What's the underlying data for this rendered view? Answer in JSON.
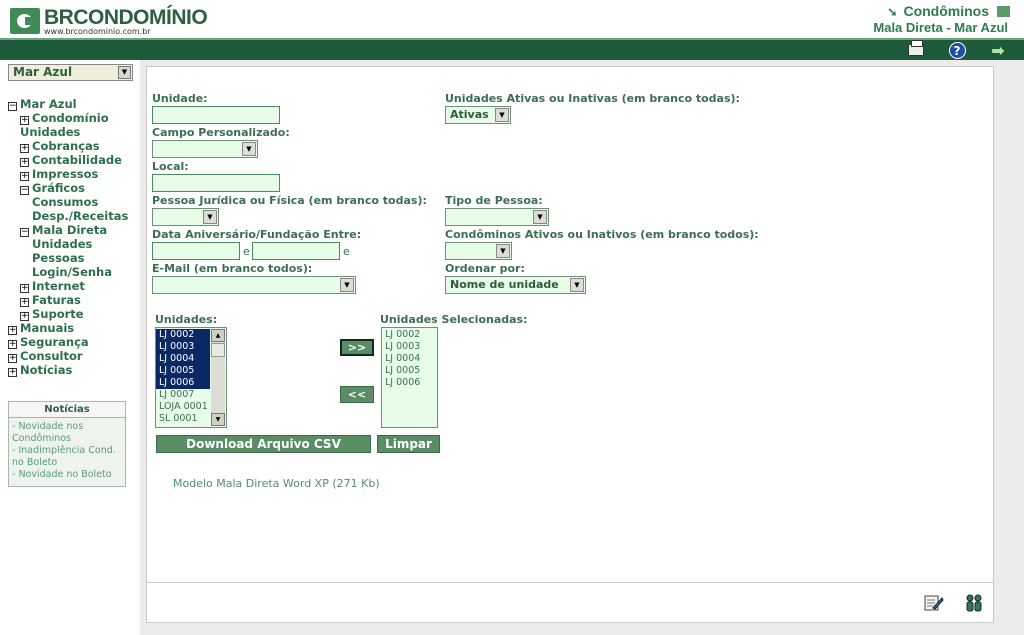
{
  "header": {
    "logo_name": "BRCONDOMÍNIO",
    "logo_url": "www.brcondominio.com.br",
    "section_title": "Condôminos",
    "subtitle": "Mala Direta - Mar Azul"
  },
  "toolbar": {
    "icons": [
      "printer-icon",
      "help-icon",
      "exit-arrow-icon"
    ]
  },
  "sidebar": {
    "condominium_select": "Mar Azul",
    "tree": [
      {
        "label": "Mar Azul",
        "level": 0,
        "toggle": "−"
      },
      {
        "label": "Condomínio",
        "level": 1,
        "toggle": "+"
      },
      {
        "label": "Unidades",
        "level": 1,
        "toggle": ""
      },
      {
        "label": "Cobranças",
        "level": 1,
        "toggle": "+"
      },
      {
        "label": "Contabilidade",
        "level": 1,
        "toggle": "+"
      },
      {
        "label": "Impressos",
        "level": 1,
        "toggle": "+"
      },
      {
        "label": "Gráficos",
        "level": 1,
        "toggle": "−"
      },
      {
        "label": "Consumos",
        "level": 2,
        "toggle": ""
      },
      {
        "label": "Desp./Receitas",
        "level": 2,
        "toggle": ""
      },
      {
        "label": "Mala Direta",
        "level": 1,
        "toggle": "−"
      },
      {
        "label": "Unidades",
        "level": 2,
        "toggle": ""
      },
      {
        "label": "Pessoas",
        "level": 2,
        "toggle": ""
      },
      {
        "label": "Login/Senha",
        "level": 2,
        "toggle": ""
      },
      {
        "label": "Internet",
        "level": 1,
        "toggle": "+"
      },
      {
        "label": "Faturas",
        "level": 1,
        "toggle": "+"
      },
      {
        "label": "Suporte",
        "level": 1,
        "toggle": "+"
      },
      {
        "label": "Manuais",
        "level": 0,
        "toggle": "+"
      },
      {
        "label": "Segurança",
        "level": 0,
        "toggle": "+"
      },
      {
        "label": "Consultor",
        "level": 0,
        "toggle": "+"
      },
      {
        "label": "Notícias",
        "level": 0,
        "toggle": "+"
      }
    ],
    "news": {
      "title": "Notícias",
      "items": [
        "- Novidade nos Condôminos",
        "- Inadimplência Cond. no Boleto",
        "- Novidade no Boleto"
      ]
    }
  },
  "form": {
    "unidade_label": "Unidade:",
    "unidade_value": "",
    "ativas_label": "Unidades Ativas ou Inativas (em branco todas):",
    "ativas_value": "Ativas",
    "campo_label": "Campo Personalizado:",
    "campo_value": "",
    "local_label": "Local:",
    "local_value": "",
    "pessoa_label": "Pessoa Jurídica ou Física (em branco todas):",
    "pessoa_value": "",
    "tipo_label": "Tipo de Pessoa:",
    "tipo_value": "",
    "data_label": "Data Aniversário/Fundação Entre:",
    "data_sep": "e",
    "data_from": "",
    "data_to": "",
    "condominos_label": "Condôminos Ativos ou Inativos (em branco todos):",
    "condominos_value": "",
    "email_label": "E-Mail (em branco todos):",
    "email_value": "",
    "ordenar_label": "Ordenar por:",
    "ordenar_value": "Nome de unidade"
  },
  "units": {
    "available_label": "Unidades:",
    "available": [
      {
        "text": "LJ 0002",
        "selected": true
      },
      {
        "text": "LJ 0003",
        "selected": true
      },
      {
        "text": "LJ 0004",
        "selected": true
      },
      {
        "text": "LJ 0005",
        "selected": true
      },
      {
        "text": "LJ 0006",
        "selected": true
      },
      {
        "text": "LJ 0007",
        "selected": false
      },
      {
        "text": "LOJA 0001",
        "selected": false
      },
      {
        "text": "SL 0001",
        "selected": false
      }
    ],
    "add_label": ">>",
    "remove_label": "<<",
    "selected_label": "Unidades Selecionadas:",
    "selected": [
      "LJ 0002",
      "LJ 0003",
      "LJ 0004",
      "LJ 0005",
      "LJ 0006"
    ]
  },
  "actions": {
    "download_label": "Download Arquivo CSV",
    "clear_label": "Limpar",
    "model_link": "Modelo Mala Direta Word XP (271 Kb)"
  },
  "footer": {
    "icons": [
      "edit-document-icon",
      "users-icon"
    ]
  }
}
